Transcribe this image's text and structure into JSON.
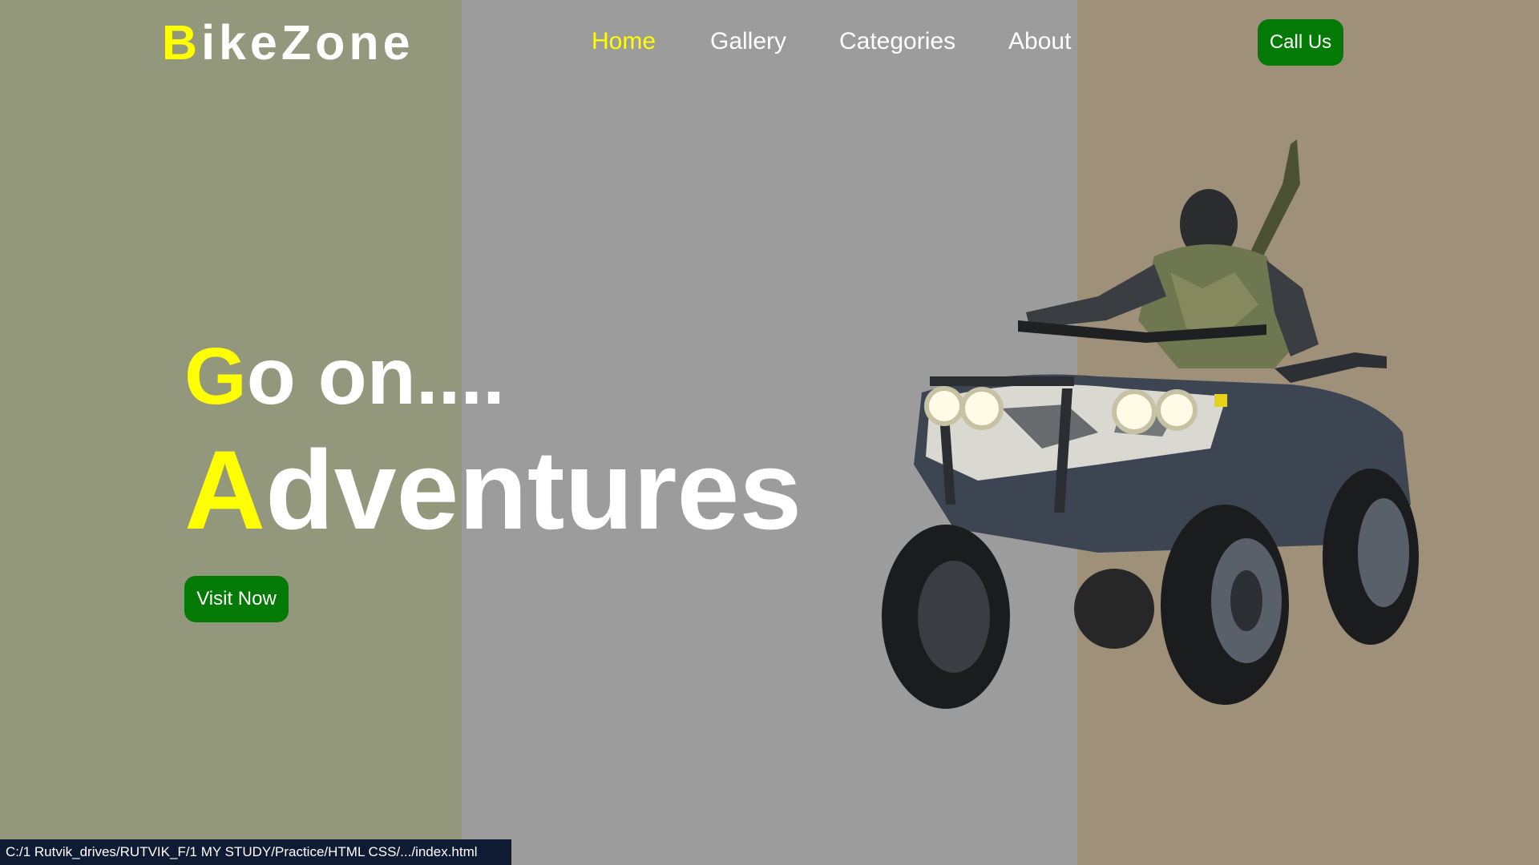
{
  "logo": {
    "first_letter": "B",
    "rest": "ikeZone"
  },
  "nav": {
    "home": "Home",
    "gallery": "Gallery",
    "categories": "Categories",
    "about": "About"
  },
  "cta": {
    "call_us": "Call Us",
    "visit_now": "Visit Now"
  },
  "hero": {
    "line1_first": "G",
    "line1_rest": "o on....",
    "line2_first": "A",
    "line2_rest": "dventures"
  },
  "status_bar": {
    "url": "C:/1 Rutvik_drives/RUTVIK_F/1 MY STUDY/Practice/HTML CSS/.../index.html"
  },
  "image": {
    "subject": "atv-rider-illustration"
  },
  "colors": {
    "accent": "#ffff00",
    "button": "#047a06",
    "panel_left": "#93977b",
    "panel_center": "#9c9c9c",
    "panel_right": "#9e9079"
  }
}
